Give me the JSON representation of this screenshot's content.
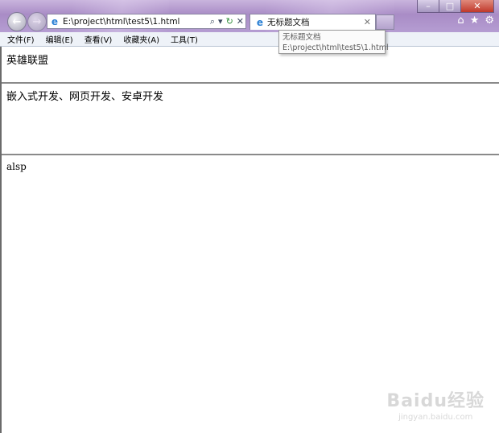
{
  "window": {
    "minimize_glyph": "–",
    "maximize_glyph": "□",
    "close_glyph": "✕"
  },
  "toolbar": {
    "back_glyph": "←",
    "forward_glyph": "→",
    "address_value": "E:\\project\\html\\test5\\1.html",
    "search_glyph": "⌕",
    "dropdown_glyph": "▾",
    "refresh_glyph": "↻",
    "stop_glyph": "✕",
    "favicon_glyph": "e",
    "home_glyph": "⌂",
    "favorites_glyph": "★",
    "settings_glyph": "⚙"
  },
  "tab": {
    "title": "无标题文档",
    "close_glyph": "✕"
  },
  "tooltip": {
    "title": "无标题文档",
    "path": "E:\\project\\html\\test5\\1.html"
  },
  "menu": {
    "items": [
      "文件(F)",
      "编辑(E)",
      "查看(V)",
      "收藏夹(A)",
      "工具(T)"
    ]
  },
  "frames": {
    "top_text": "英雄联盟",
    "middle_text": "嵌入式开发、网页开发、安卓开发",
    "bottom_text": "alsp"
  },
  "watermark": {
    "brand": "Baidu经验",
    "site": "jingyan.baidu.com"
  },
  "colors": {
    "chrome": "#a98cc6",
    "menubar": "#eef2f8",
    "frame_border": "#8a8a8a"
  }
}
